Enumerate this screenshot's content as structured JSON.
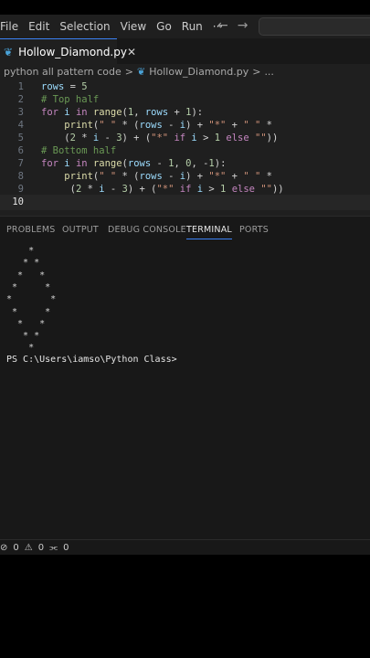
{
  "menu": [
    "File",
    "Edit",
    "Selection",
    "View",
    "Go",
    "Run",
    "···"
  ],
  "nav": {
    "back_icon": "←",
    "forward_icon": "→"
  },
  "tab": {
    "label": "Hollow_Diamond.py",
    "close": "✕",
    "icon": "python-file-icon"
  },
  "breadcrumb": {
    "folder": "python all pattern code",
    "sep": ">",
    "file": "Hollow_Diamond.py",
    "sep2": ">",
    "more": "..."
  },
  "editor": {
    "lines": [
      {
        "n": "1",
        "segments": [
          [
            "var",
            "rows"
          ],
          [
            "op",
            " = "
          ],
          [
            "num",
            "5"
          ]
        ]
      },
      {
        "n": "2",
        "segments": [
          [
            "cm",
            "# Top half"
          ]
        ]
      },
      {
        "n": "3",
        "segments": [
          [
            "kw",
            "for"
          ],
          [
            "op",
            " "
          ],
          [
            "var",
            "i"
          ],
          [
            "op",
            " "
          ],
          [
            "kw",
            "in"
          ],
          [
            "op",
            " "
          ],
          [
            "fn",
            "range"
          ],
          [
            "op",
            "("
          ],
          [
            "num",
            "1"
          ],
          [
            "op",
            ", "
          ],
          [
            "var",
            "rows"
          ],
          [
            "op",
            " + "
          ],
          [
            "num",
            "1"
          ],
          [
            "op",
            "):"
          ]
        ]
      },
      {
        "n": "4",
        "segments": [
          [
            "op",
            "    "
          ],
          [
            "fn",
            "print"
          ],
          [
            "op",
            "("
          ],
          [
            "str",
            "\" \""
          ],
          [
            "op",
            " * ("
          ],
          [
            "var",
            "rows"
          ],
          [
            "op",
            " - "
          ],
          [
            "var",
            "i"
          ],
          [
            "op",
            ") + "
          ],
          [
            "str",
            "\"*\""
          ],
          [
            "op",
            " + "
          ],
          [
            "str",
            "\" \""
          ],
          [
            "op",
            " *"
          ]
        ]
      },
      {
        "n": "5",
        "segments": [
          [
            "op",
            "    ("
          ],
          [
            "num",
            "2"
          ],
          [
            "op",
            " * "
          ],
          [
            "var",
            "i"
          ],
          [
            "op",
            " - "
          ],
          [
            "num",
            "3"
          ],
          [
            "op",
            ") + ("
          ],
          [
            "str",
            "\"*\""
          ],
          [
            "op",
            " "
          ],
          [
            "kw",
            "if"
          ],
          [
            "op",
            " "
          ],
          [
            "var",
            "i"
          ],
          [
            "op",
            " > "
          ],
          [
            "num",
            "1"
          ],
          [
            "op",
            " "
          ],
          [
            "kw",
            "else"
          ],
          [
            "op",
            " "
          ],
          [
            "str",
            "\"\""
          ],
          [
            "op",
            "))"
          ]
        ]
      },
      {
        "n": "6",
        "segments": [
          [
            "cm",
            "# Bottom half"
          ]
        ]
      },
      {
        "n": "7",
        "segments": [
          [
            "kw",
            "for"
          ],
          [
            "op",
            " "
          ],
          [
            "var",
            "i"
          ],
          [
            "op",
            " "
          ],
          [
            "kw",
            "in"
          ],
          [
            "op",
            " "
          ],
          [
            "fn",
            "range"
          ],
          [
            "op",
            "("
          ],
          [
            "var",
            "rows"
          ],
          [
            "op",
            " - "
          ],
          [
            "num",
            "1"
          ],
          [
            "op",
            ", "
          ],
          [
            "num",
            "0"
          ],
          [
            "op",
            ", -"
          ],
          [
            "num",
            "1"
          ],
          [
            "op",
            "):"
          ]
        ]
      },
      {
        "n": "8",
        "segments": [
          [
            "op",
            "    "
          ],
          [
            "fn",
            "print"
          ],
          [
            "op",
            "("
          ],
          [
            "str",
            "\" \""
          ],
          [
            "op",
            " * ("
          ],
          [
            "var",
            "rows"
          ],
          [
            "op",
            " - "
          ],
          [
            "var",
            "i"
          ],
          [
            "op",
            ") + "
          ],
          [
            "str",
            "\"*\""
          ],
          [
            "op",
            " + "
          ],
          [
            "str",
            "\" \""
          ],
          [
            "op",
            " *"
          ]
        ]
      },
      {
        "n": "9",
        "segments": [
          [
            "op",
            "     ("
          ],
          [
            "num",
            "2"
          ],
          [
            "op",
            " * "
          ],
          [
            "var",
            "i"
          ],
          [
            "op",
            " - "
          ],
          [
            "num",
            "3"
          ],
          [
            "op",
            ") + ("
          ],
          [
            "str",
            "\"*\""
          ],
          [
            "op",
            " "
          ],
          [
            "kw",
            "if"
          ],
          [
            "op",
            " "
          ],
          [
            "var",
            "i"
          ],
          [
            "op",
            " > "
          ],
          [
            "num",
            "1"
          ],
          [
            "op",
            " "
          ],
          [
            "kw",
            "else"
          ],
          [
            "op",
            " "
          ],
          [
            "str",
            "\"\""
          ],
          [
            "op",
            "))"
          ]
        ]
      },
      {
        "n": "10",
        "segments": []
      }
    ]
  },
  "panel": {
    "tabs": [
      "PROBLEMS",
      "OUTPUT",
      "DEBUG CONSOLE",
      "TERMINAL",
      "PORTS"
    ],
    "active_tab": "TERMINAL",
    "output": [
      "    *",
      "   * *",
      "  *   *",
      " *     *",
      "*       *",
      " *     *",
      "  *   *",
      "   * *",
      "    *"
    ],
    "prompt": "PS C:\\Users\\iamso\\Python Class>"
  },
  "status": {
    "errors": "0",
    "warnings": "0",
    "ports": "0",
    "error_icon": "⊘",
    "warning_icon": "⚠",
    "ports_icon": "⫘"
  }
}
